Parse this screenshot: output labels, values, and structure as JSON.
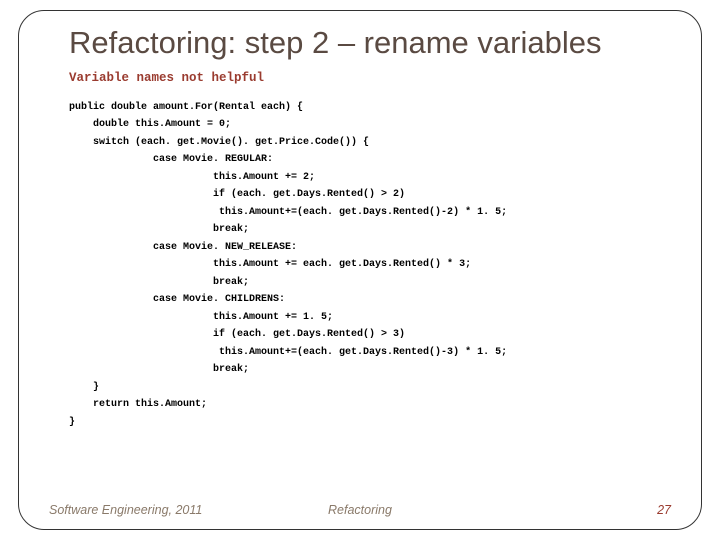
{
  "slide": {
    "title": "Refactoring: step 2 – rename variables",
    "subhead": "Variable names not helpful",
    "code": "public double amount.For(Rental each) {\n    double this.Amount = 0;\n    switch (each. get.Movie(). get.Price.Code()) {\n              case Movie. REGULAR:\n                        this.Amount += 2;\n                        if (each. get.Days.Rented() > 2)\n                         this.Amount+=(each. get.Days.Rented()-2) * 1. 5;\n                        break;\n              case Movie. NEW_RELEASE:\n                        this.Amount += each. get.Days.Rented() * 3;\n                        break;\n              case Movie. CHILDRENS:\n                        this.Amount += 1. 5;\n                        if (each. get.Days.Rented() > 3)\n                         this.Amount+=(each. get.Days.Rented()-3) * 1. 5;\n                        break;\n    }\n    return this.Amount;\n}"
  },
  "footer": {
    "left": "Software Engineering, 2011",
    "center": "Refactoring",
    "page": "27"
  }
}
